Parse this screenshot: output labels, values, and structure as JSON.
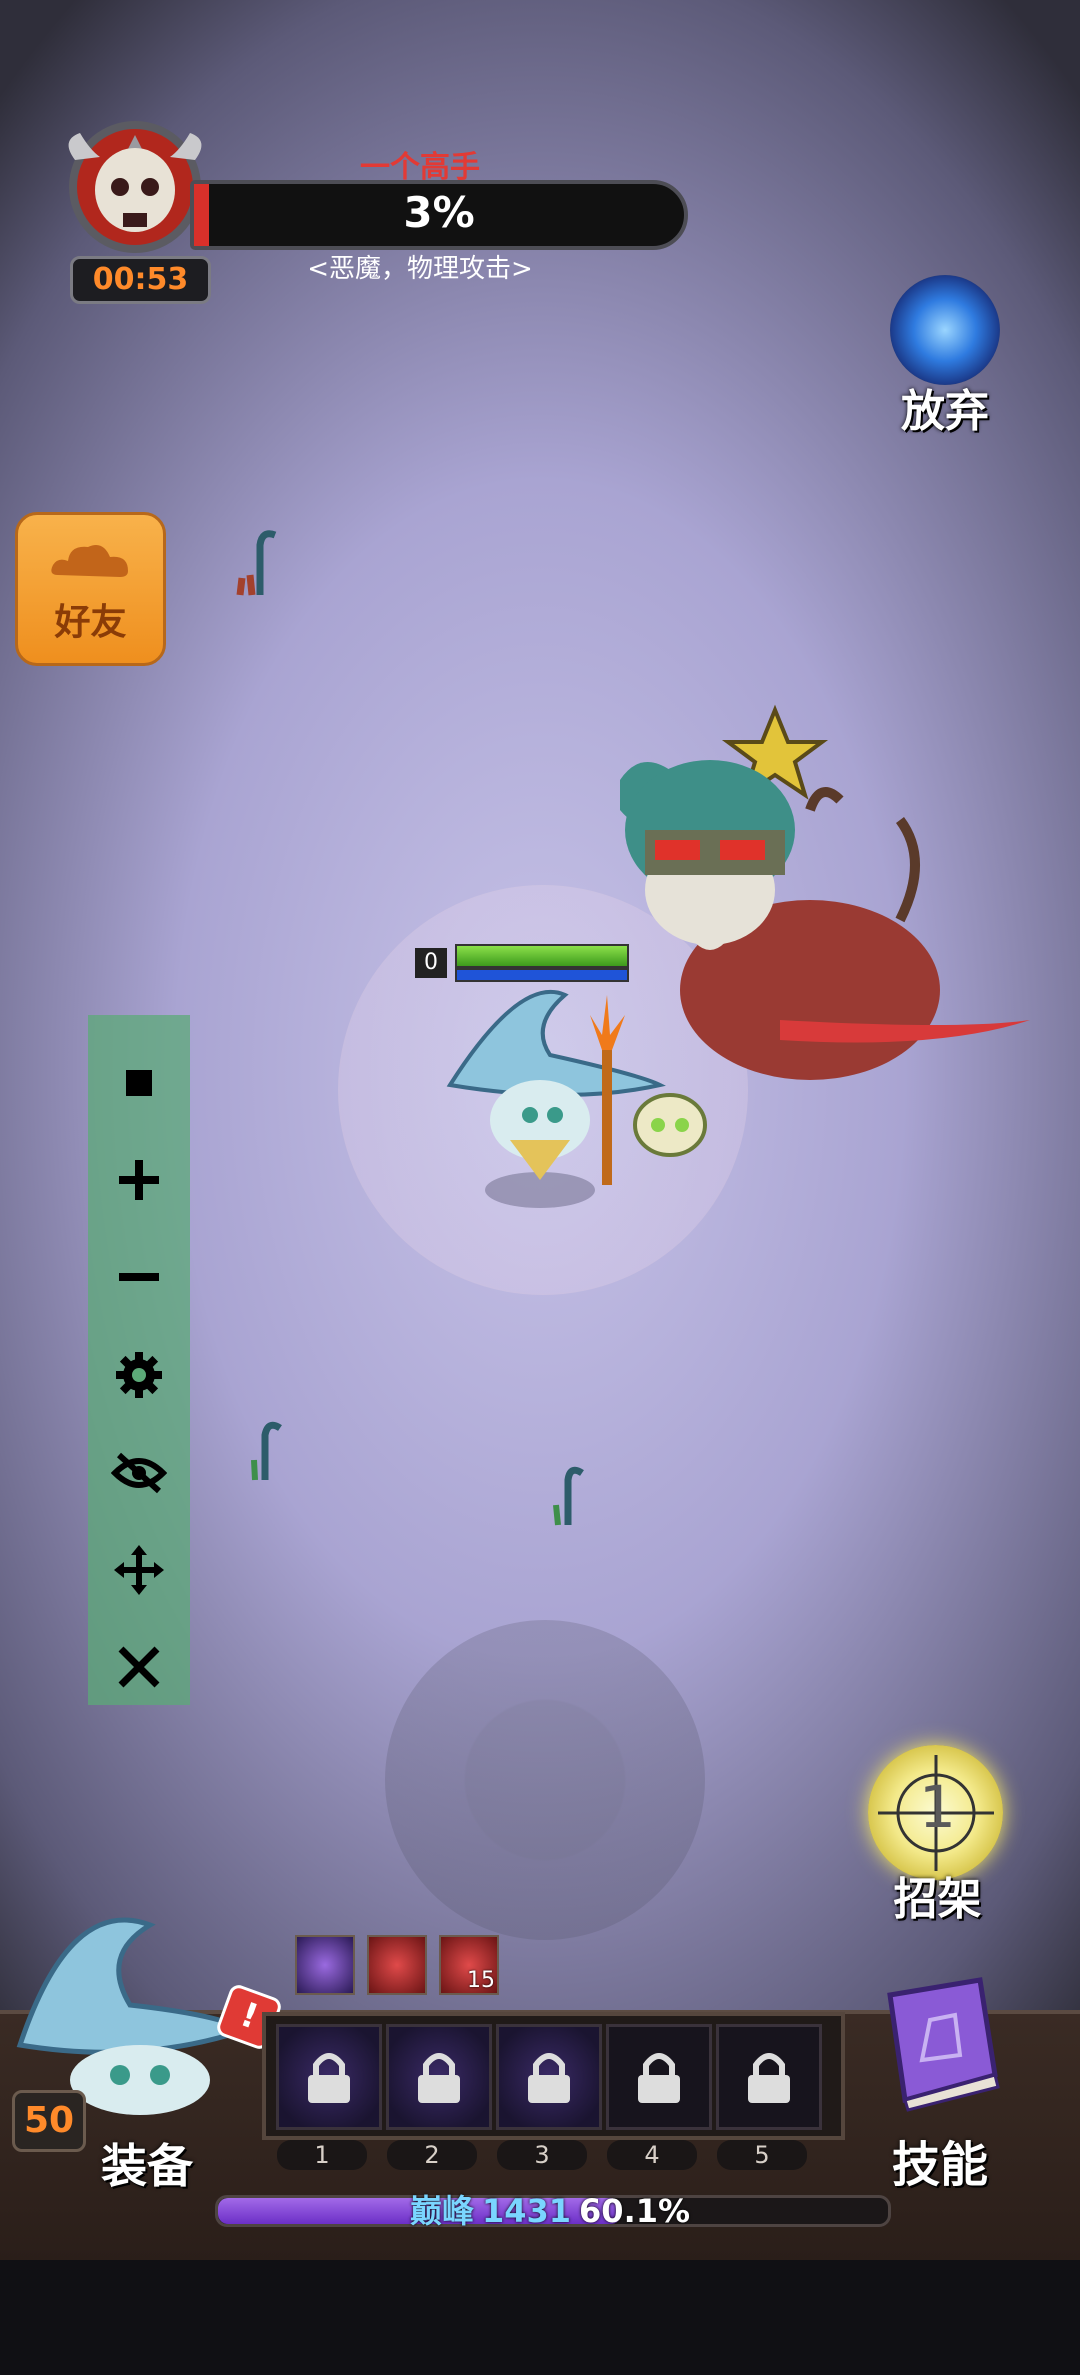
{
  "boss": {
    "name": "一个高手",
    "health_percent_text": "3%",
    "health_fraction": 0.03,
    "traits": "<恶魔，物理攻击>",
    "timer": "00:53",
    "icon": "horned-skull-icon"
  },
  "give_up": {
    "label": "放弃",
    "icon": "portal-orb-icon"
  },
  "friends": {
    "label": "好友",
    "icon": "cloud-icon"
  },
  "toolbar": {
    "icons": [
      "stop-icon",
      "plus-icon",
      "minus-icon",
      "gear-icon",
      "eye-off-icon",
      "move-icon",
      "close-icon"
    ]
  },
  "hero": {
    "level_indicator": "0",
    "health_fraction": 1.0,
    "icon": "wizard-hat-icon"
  },
  "parry": {
    "label": "招架",
    "count": "1",
    "icon": "crosshair-icon"
  },
  "buffs": [
    {
      "icon": "purple-crystal-icon"
    },
    {
      "icon": "red-crown-icon"
    },
    {
      "icon": "red-sword-icon",
      "count": "15"
    }
  ],
  "skill_slots": [
    {
      "number": "1",
      "locked": true,
      "icon": "lock-icon"
    },
    {
      "number": "2",
      "locked": true,
      "icon": "lock-icon"
    },
    {
      "number": "3",
      "locked": true,
      "icon": "lock-icon"
    },
    {
      "number": "4",
      "locked": true,
      "icon": "lock-icon"
    },
    {
      "number": "5",
      "locked": true,
      "icon": "lock-icon"
    }
  ],
  "player": {
    "level": "50",
    "equip_label": "装备",
    "alert": "!"
  },
  "skills": {
    "label": "技能",
    "icon": "spellbook-icon"
  },
  "experience": {
    "title": "巅峰",
    "level": "1431",
    "percent_text": "60.1%",
    "fraction": 0.601
  },
  "colors": {
    "boss_bar": "#d8302a",
    "xp_bar": "#8a4fd8",
    "friends_button": "#f2a030",
    "toolbar": "#5caa78"
  }
}
